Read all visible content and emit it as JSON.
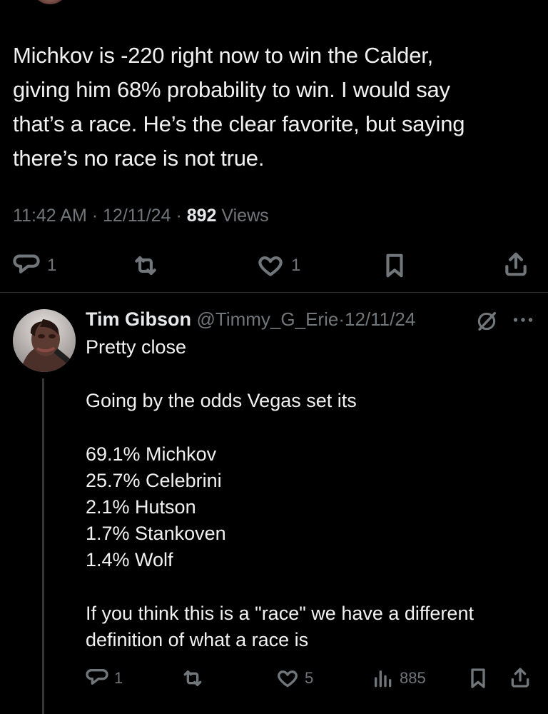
{
  "main_tweet": {
    "text": "Michkov is -220 right now to win the Calder,\ngiving him 68% probability to win. I would say\nthat’s a race. He’s the clear favorite, but saying\nthere’s no race is not true.",
    "time": "11:42 AM",
    "date": "12/11/24",
    "views_count": "892",
    "views_label": "Views",
    "separator": "·",
    "actions": {
      "replies": "1",
      "reposts": "",
      "likes": "1"
    }
  },
  "reply": {
    "name": "Tim Gibson",
    "handle": "@Timmy_G_Erie",
    "separator": "·",
    "date": "12/11/24",
    "paragraphs": [
      "Pretty close",
      "Going by the odds Vegas set its",
      "69.1% Michkov\n25.7% Celebrini\n2.1% Hutson\n1.7% Stankoven\n1.4% Wolf",
      "If you think this is a \"race\" we have a different\ndefinition of what a race is"
    ],
    "actions": {
      "replies": "1",
      "reposts": "",
      "likes": "5",
      "views": "885"
    }
  },
  "icons": {
    "reply": "reply-icon",
    "repost": "repost-icon",
    "like": "heart-icon",
    "bookmark": "bookmark-icon",
    "share": "share-icon",
    "views": "views-chart-icon",
    "grok": "grok-icon",
    "more": "more-icon"
  },
  "colors": {
    "background": "#000000",
    "text": "#e7e9ea",
    "secondary": "#71767b",
    "divider": "#2f3336"
  }
}
